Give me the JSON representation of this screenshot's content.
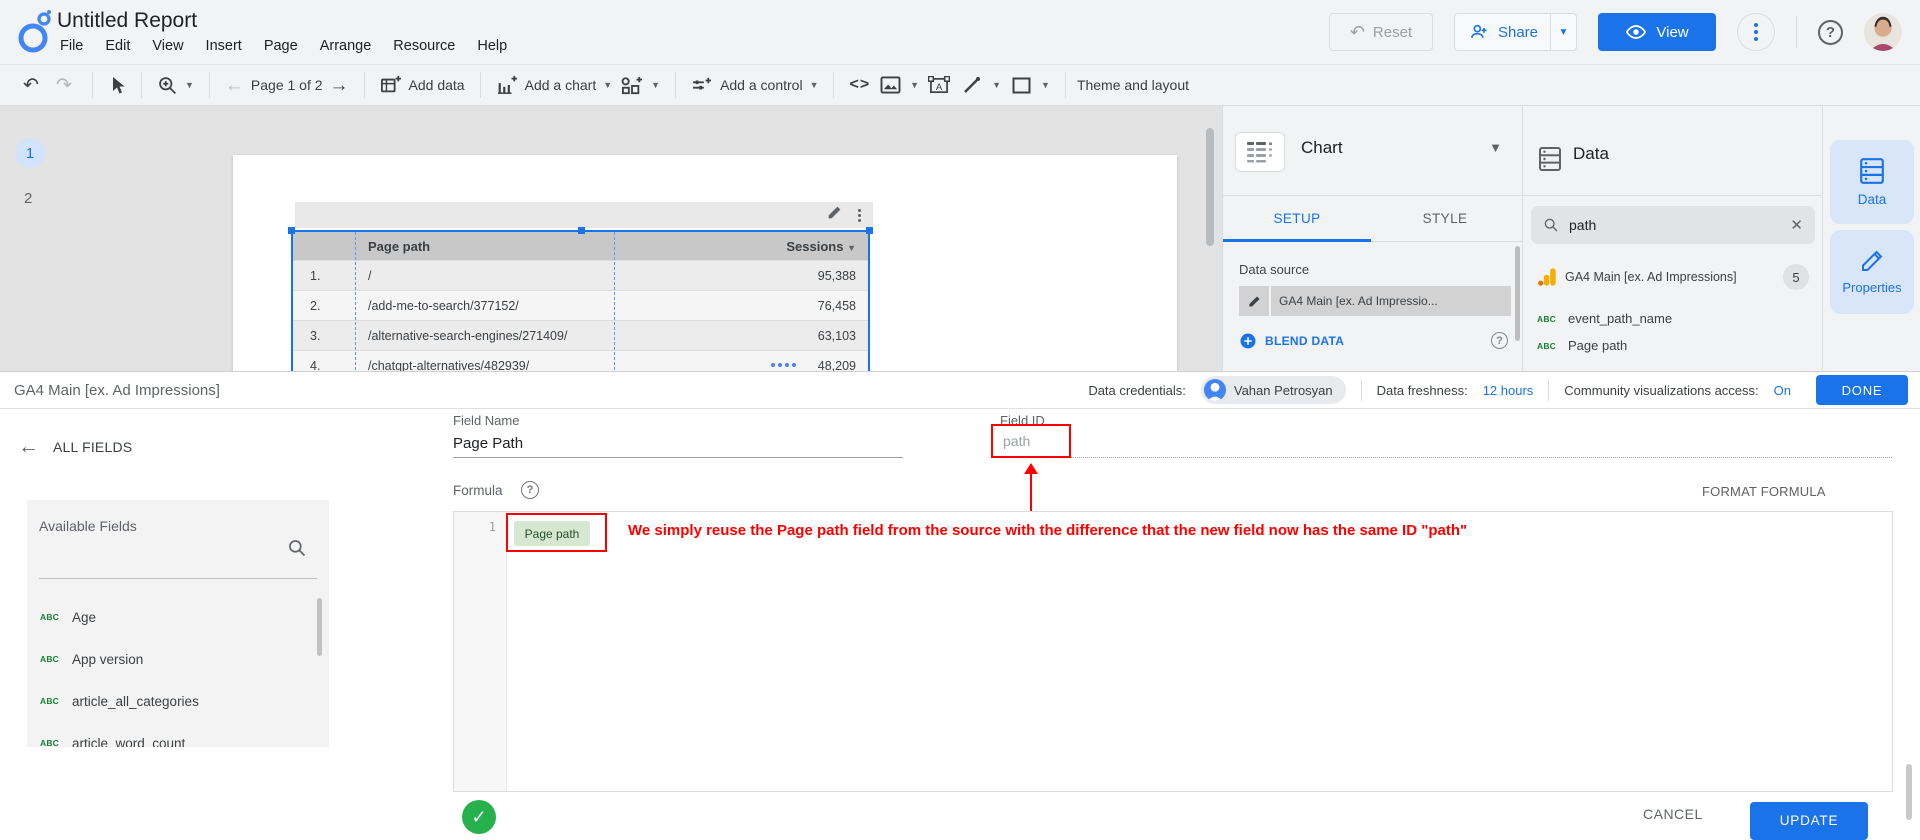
{
  "app": {
    "title": "Untitled Report"
  },
  "header": {
    "menus": [
      "File",
      "Edit",
      "View",
      "Insert",
      "Page",
      "Arrange",
      "Resource",
      "Help"
    ],
    "reset_label": "Reset",
    "share_label": "Share",
    "view_label": "View"
  },
  "toolbar": {
    "page_nav": "Page 1 of 2",
    "add_data_label": "Add data",
    "add_chart_label": "Add a chart",
    "add_control_label": "Add a control",
    "embed_glyph": "<>",
    "theme_label": "Theme and layout"
  },
  "canvas": {
    "page_numbers": [
      "1",
      "2"
    ],
    "table": {
      "columns": [
        "Page path",
        "Sessions"
      ],
      "rows": [
        {
          "n": "1.",
          "path": "/",
          "sessions": "95,388"
        },
        {
          "n": "2.",
          "path": "/add-me-to-search/377152/",
          "sessions": "76,458"
        },
        {
          "n": "3.",
          "path": "/alternative-search-engines/271409/",
          "sessions": "63,103"
        },
        {
          "n": "4.",
          "path": "/chatgpt-alternatives/482939/",
          "sessions": "48,209"
        }
      ]
    }
  },
  "chart_panel": {
    "title": "Chart",
    "tab_setup": "SETUP",
    "tab_style": "STYLE",
    "data_source_label": "Data source",
    "data_source_name": "GA4 Main [ex. Ad Impressio...",
    "blend_label": "BLEND DATA"
  },
  "data_panel": {
    "title": "Data",
    "search_value": "path",
    "source_name": "GA4 Main [ex. Ad Impressions]",
    "source_badge": "5",
    "fields": [
      "event_path_name",
      "Page path"
    ]
  },
  "rail": {
    "data_label": "Data",
    "properties_label": "Properties"
  },
  "source_bar": {
    "name": "GA4 Main [ex. Ad Impressions]",
    "credentials_label": "Data credentials:",
    "credentials_user": "Vahan Petrosyan",
    "freshness_label": "Data freshness:",
    "freshness_value": "12 hours",
    "viz_label": "Community visualizations access:",
    "viz_value": "On",
    "done_label": "DONE"
  },
  "editor": {
    "back_label": "ALL FIELDS",
    "available_title": "Available Fields",
    "available_fields": [
      "Age",
      "App version",
      "article_all_categories",
      "article_word_count"
    ],
    "field_name_label": "Field Name",
    "field_name_value": "Page Path",
    "field_id_label": "Field ID",
    "field_id_value": "path",
    "formula_label": "Formula",
    "format_formula_label": "FORMAT FORMULA",
    "line_number": "1",
    "formula_chip": "Page path",
    "annotation": "We simply reuse the Page path field from the source with the difference that the new field now has the same ID \"path\"",
    "cancel_label": "CANCEL",
    "update_label": "UPDATE"
  },
  "colors": {
    "accent": "#1a73e8",
    "annotation_red": "#ff0000",
    "chip_green_bg": "#d6e7d2",
    "success_green": "#27b14c",
    "ga_orange": "#f9ab00"
  }
}
